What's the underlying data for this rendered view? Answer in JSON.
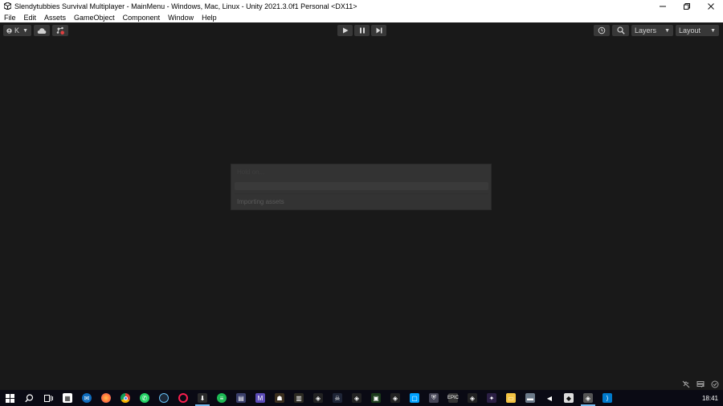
{
  "window": {
    "title": "Slendytubbies Survival Multiplayer - MainMenu - Windows, Mac, Linux - Unity 2021.3.0f1 Personal <DX11>"
  },
  "menu": [
    "File",
    "Edit",
    "Assets",
    "GameObject",
    "Component",
    "Window",
    "Help"
  ],
  "toolbar": {
    "account_label": "K",
    "layers_label": "Layers",
    "layout_label": "Layout"
  },
  "dialog": {
    "title": "Hold on...",
    "status": "Importing assets",
    "progress": 1.0
  },
  "taskbar": {
    "icons": [
      "windows-start",
      "search",
      "task-view",
      "teams",
      "outlook",
      "firefox",
      "chrome",
      "whatsapp",
      "steam",
      "opera-gx",
      "epic-games-active",
      "spotify",
      "unity-hub",
      "app-1",
      "app-2",
      "app-3",
      "app-4",
      "app-5",
      "app-6",
      "app-7",
      "app-8",
      "app-9",
      "app-10",
      "app-11",
      "app-12",
      "app-13",
      "app-14",
      "file-explorer",
      "app-15",
      "app-16",
      "app-17",
      "unity-active",
      "vscode"
    ],
    "clock": "18:41"
  },
  "colors": {
    "editor_bg": "#191919",
    "titlebar_bg": "#ffffff",
    "button_bg": "#383838",
    "dialog_bg": "#333333",
    "taskbar_bg": "#0a0a14"
  }
}
